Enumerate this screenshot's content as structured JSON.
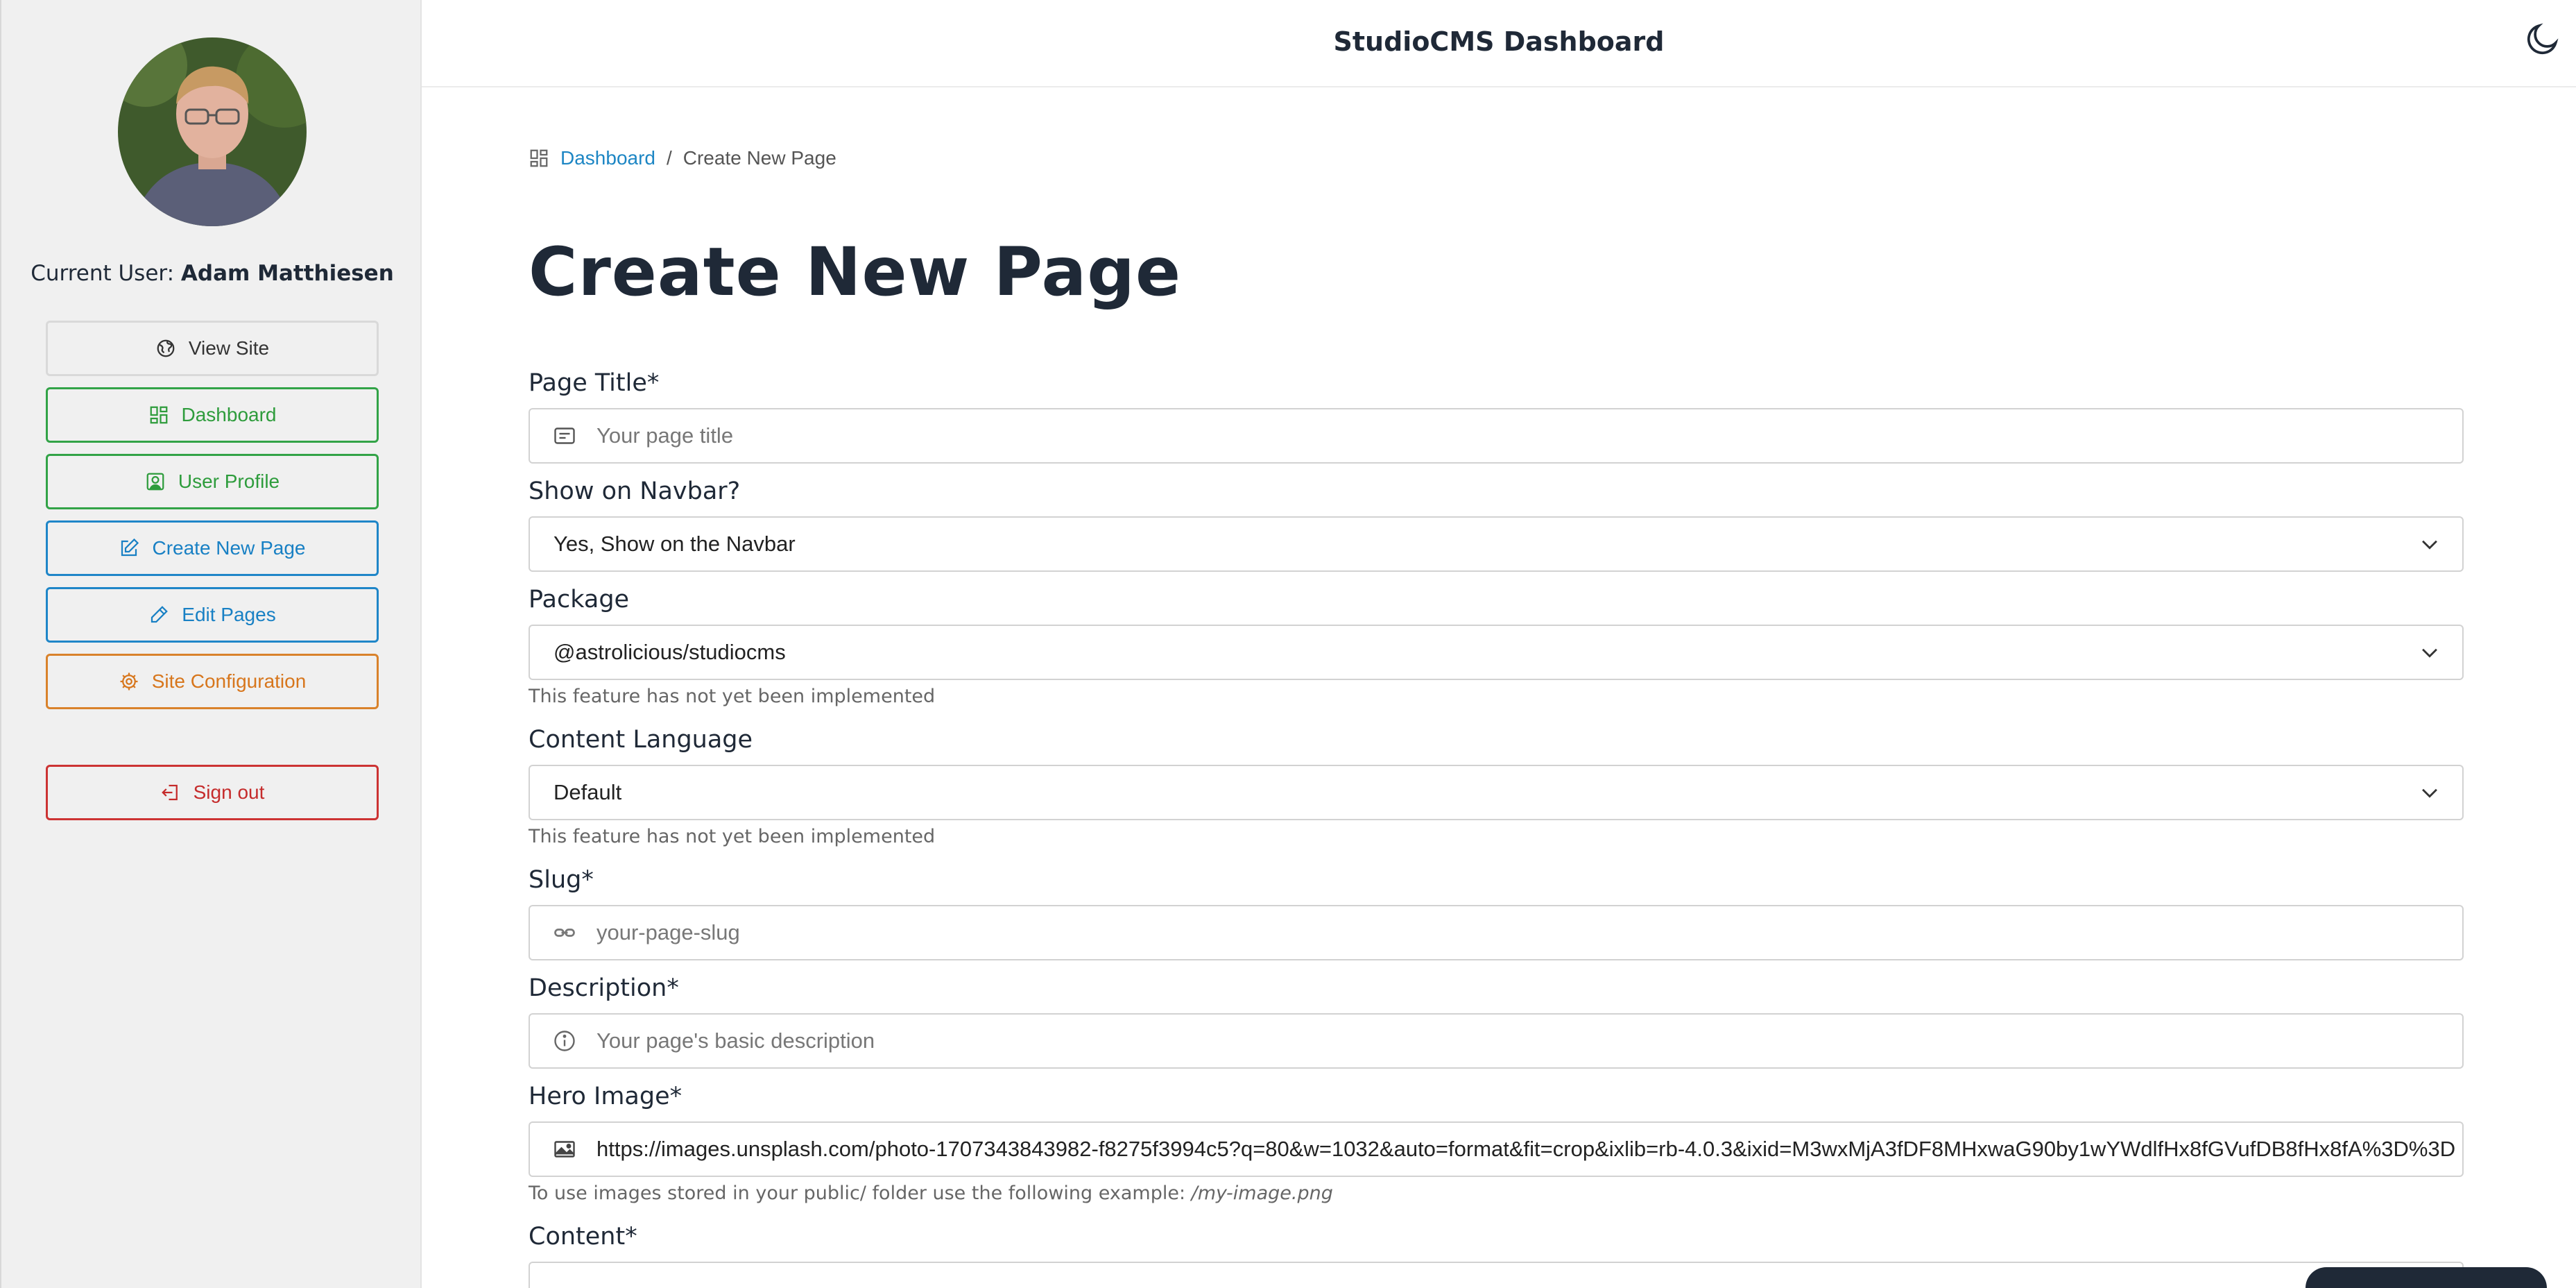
{
  "sidebar": {
    "current_user_prefix": "Current User:",
    "current_user_name": "Adam Matthiesen",
    "buttons": {
      "view_site": "View Site",
      "dashboard": "Dashboard",
      "user_profile": "User Profile",
      "create_new_page": "Create New Page",
      "edit_pages": "Edit Pages",
      "site_configuration": "Site Configuration",
      "sign_out": "Sign out"
    }
  },
  "header": {
    "title": "StudioCMS Dashboard"
  },
  "breadcrumb": {
    "root": "Dashboard",
    "separator": "/",
    "current": "Create New Page"
  },
  "page": {
    "title": "Create New Page"
  },
  "form": {
    "page_title": {
      "label": "Page Title",
      "required": "*",
      "placeholder": "Your page title"
    },
    "show_on_navbar": {
      "label": "Show on Navbar?",
      "value": "Yes, Show on the Navbar"
    },
    "package": {
      "label": "Package",
      "value": "@astrolicious/studiocms",
      "hint": "This feature has not yet been implemented"
    },
    "content_language": {
      "label": "Content Language",
      "value": "Default",
      "hint": "This feature has not yet been implemented"
    },
    "slug": {
      "label": "Slug",
      "required": "*",
      "placeholder": "your-page-slug"
    },
    "description": {
      "label": "Description",
      "required": "*",
      "placeholder": "Your page's basic description"
    },
    "hero_image": {
      "label": "Hero Image",
      "required": "*",
      "value": "https://images.unsplash.com/photo-1707343843982-f8275f3994c5?q=80&w=1032&auto=format&fit=crop&ixlib=rb-4.0.3&ixid=M3wxMjA3fDF8MHxwaG90by1wYWdlfHx8fGVufDB8fHx8fA%3D%3D",
      "hint_prefix": "To use images stored in your public/ folder use the following example:",
      "hint_example": "/my-image.png"
    },
    "content": {
      "label": "Content",
      "required": "*"
    }
  },
  "colors": {
    "green": "#32a347",
    "blue": "#1f86c8",
    "orange": "#d9822b",
    "red": "#cc3333"
  }
}
